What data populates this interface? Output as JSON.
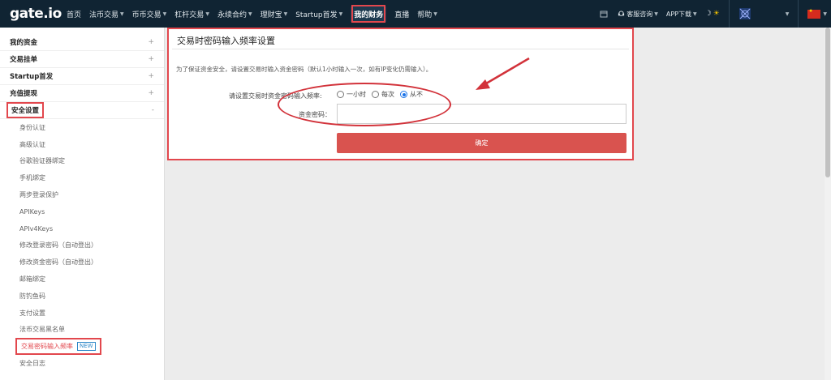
{
  "logo": "gate.io",
  "nav": {
    "items": [
      {
        "label": "首页",
        "caret": false
      },
      {
        "label": "法币交易",
        "caret": true
      },
      {
        "label": "币币交易",
        "caret": true
      },
      {
        "label": "杠杆交易",
        "caret": true
      },
      {
        "label": "永续合约",
        "caret": true
      },
      {
        "label": "理财宝",
        "caret": true
      },
      {
        "label": "Startup首发",
        "caret": true
      },
      {
        "label": "我的财务",
        "caret": false,
        "active": true
      },
      {
        "label": "直播",
        "caret": false
      },
      {
        "label": "帮助",
        "caret": true
      }
    ],
    "support": "客服咨询",
    "app_download": "APP下载"
  },
  "sidebar": {
    "sections": [
      {
        "label": "我的资金",
        "toggle": "+"
      },
      {
        "label": "交易挂单",
        "toggle": "+"
      },
      {
        "label": "Startup首发",
        "toggle": "+"
      },
      {
        "label": "充值提现",
        "toggle": "+"
      },
      {
        "label": "安全设置",
        "toggle": "-"
      }
    ],
    "security_items": [
      "身份认证",
      "高级认证",
      "谷歌验证器绑定",
      "手机绑定",
      "两步登录保护",
      "APIKeys",
      "APIv4Keys",
      "修改登录密码（自动登出）",
      "修改资金密码（自动登出）",
      "邮箱绑定",
      "防钓鱼码",
      "支付设置",
      "法币交易黑名单"
    ],
    "active_item": "交易密码输入频率",
    "active_badge": "NEW",
    "last_item": "安全日志"
  },
  "panel": {
    "title": "交易时密码输入频率设置",
    "description": "为了保证资金安全，请设置交易时输入资金密码（默认1小时输入一次，如有IP变化仍需输入）。",
    "frequency_label": "请设置交易时资金密码输入频率:",
    "options": [
      "一小时",
      "每次",
      "从不"
    ],
    "selected_option": "从不",
    "password_label": "资金密码：",
    "password_value": "",
    "confirm_label": "确定"
  },
  "colors": {
    "topbar": "#102433",
    "highlight": "#e2474d",
    "confirm": "#d9534f",
    "link_blue": "#2f88c8"
  }
}
